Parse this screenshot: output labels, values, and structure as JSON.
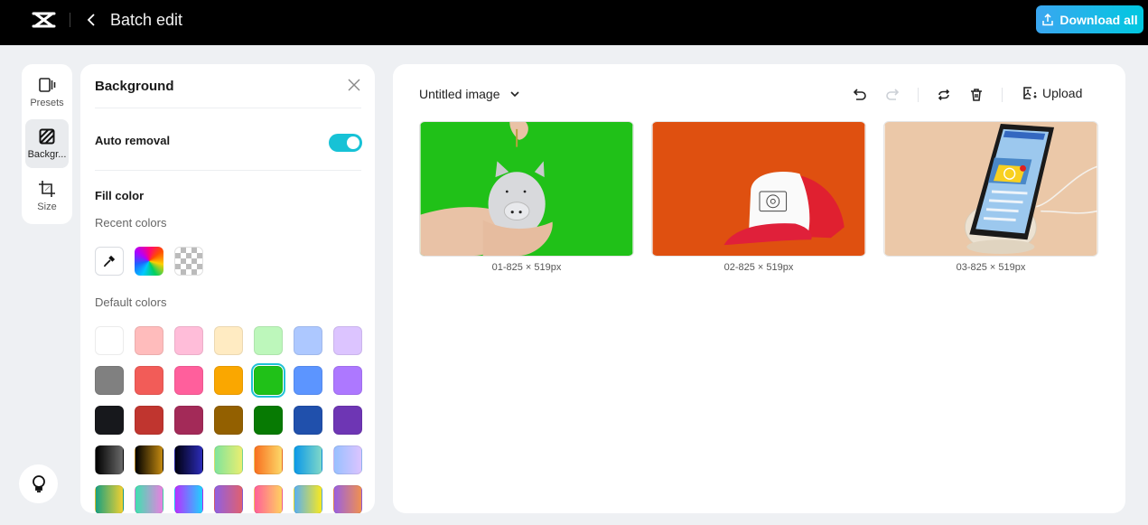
{
  "header": {
    "title": "Batch edit",
    "download_label": "Download all"
  },
  "rail": {
    "items": [
      {
        "label": "Presets",
        "icon": "presets-icon",
        "active": false
      },
      {
        "label": "Backgr...",
        "icon": "background-icon",
        "active": true
      },
      {
        "label": "Size",
        "icon": "crop-icon",
        "active": false
      }
    ]
  },
  "panel": {
    "title": "Background",
    "auto_removal_label": "Auto removal",
    "auto_removal_on": true,
    "fill_color_label": "Fill color",
    "recent_colors_label": "Recent colors",
    "default_colors_label": "Default colors",
    "recent": [
      "eyedropper",
      "custom-color-picker",
      "transparent"
    ],
    "default_colors": [
      "#ffffff",
      "#ffbcbc",
      "#ffbdd9",
      "#ffebc2",
      "#bdf7bb",
      "#adc8ff",
      "#dcc4ff",
      "#808080",
      "#f25c58",
      "#ff5f9c",
      "#faa700",
      "#20c118",
      "#5c95ff",
      "#ad78ff",
      "#17181c",
      "#c0352f",
      "#a32a58",
      "#936000",
      "#077a03",
      "#2050ac",
      "#6e36b4",
      "linear-gradient(90deg,#000000,#6a6a6a)",
      "linear-gradient(90deg,#000000,#c48a10)",
      "linear-gradient(90deg,#000010,#2c2cb8)",
      "linear-gradient(90deg,#80e49c,#eaee70)",
      "linear-gradient(90deg,#f87020,#fdd868)",
      "linear-gradient(90deg,#0a98e8,#80d8c8)",
      "linear-gradient(90deg,#98c0ff,#dcc4ff)",
      "linear-gradient(90deg,#1aa080,#f0d030)",
      "linear-gradient(90deg,#40e0b0,#e880e0)",
      "linear-gradient(90deg,#b830ff,#20d0ff)",
      "linear-gradient(90deg,#9060e0,#e06070)",
      "linear-gradient(90deg,#ff6098,#ffd060)",
      "linear-gradient(90deg,#5ab0f0,#f8e820)",
      "linear-gradient(90deg,#9a60e0,#f09050)"
    ],
    "selected_index": 11
  },
  "main": {
    "doc_title": "Untitled image",
    "upload_label": "Upload",
    "images": [
      {
        "caption": "01-825 × 519px",
        "bg": "#20c118",
        "subject": "piggy bank in hand"
      },
      {
        "caption": "02-825 × 519px",
        "bg": "#df5010",
        "subject": "red trucker cap"
      },
      {
        "caption": "03-825 × 519px",
        "bg": "#ebc8a8",
        "subject": "phone on wireless charger"
      }
    ]
  },
  "colors": {
    "accent": "#17c2d6",
    "topbar": "#000000",
    "page_bg": "#eef0f3"
  }
}
